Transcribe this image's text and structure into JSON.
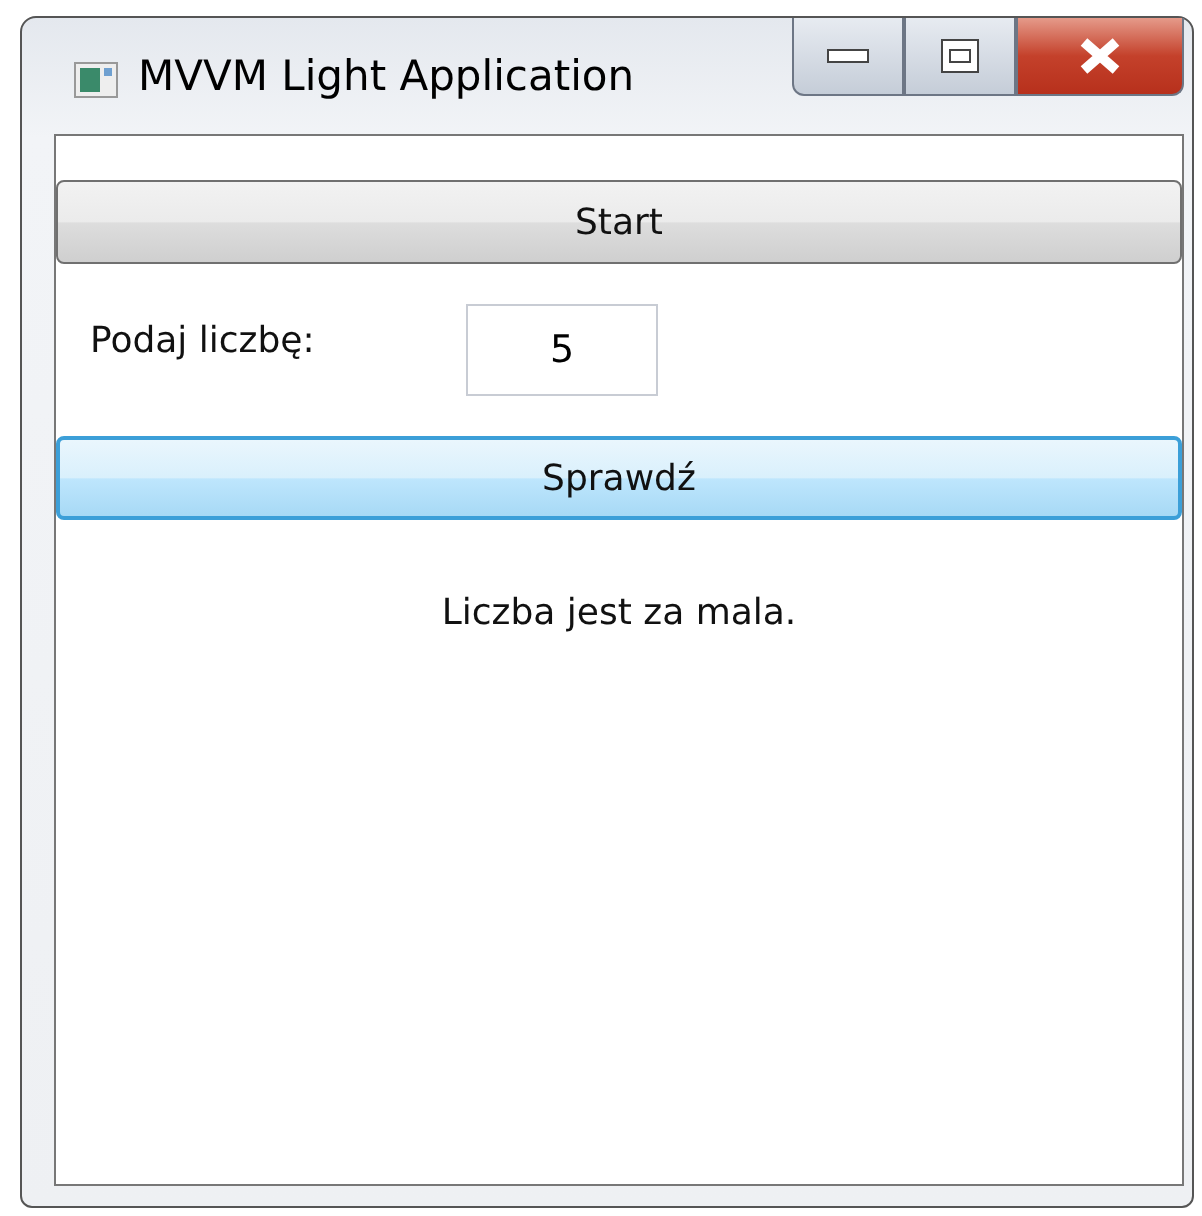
{
  "window": {
    "title": "MVVM Light Application"
  },
  "start_button": {
    "label": "Start",
    "focused": false
  },
  "number_input": {
    "label": "Podaj liczbę:",
    "value": "5"
  },
  "check_button": {
    "label": "Sprawdź",
    "focused": true
  },
  "result": {
    "text": "Liczba jest za mala."
  }
}
